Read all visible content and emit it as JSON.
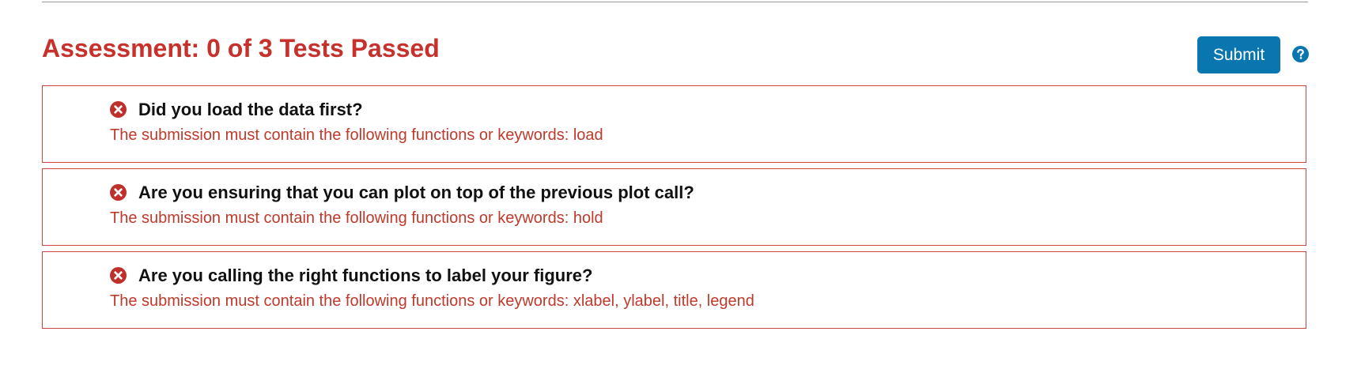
{
  "assessment": {
    "title": "Assessment: 0 of 3 Tests Passed",
    "submit_label": "Submit",
    "help_icon": "question-circle-icon"
  },
  "tests": [
    {
      "title": "Did you load the data first?",
      "message": "The submission must contain the following functions or keywords: load",
      "status": "failed",
      "icon": "x-circle-icon"
    },
    {
      "title": "Are you ensuring that you can plot on top of the previous plot call?",
      "message": "The submission must contain the following functions or keywords: hold",
      "status": "failed",
      "icon": "x-circle-icon"
    },
    {
      "title": "Are you calling the right functions to label your figure?",
      "message": "The submission must contain the following functions or keywords: xlabel, ylabel, title, legend",
      "status": "failed",
      "icon": "x-circle-icon"
    }
  ],
  "colors": {
    "fail_red": "#c8312b",
    "card_border": "#cc4440",
    "submit_blue": "#0a76b0"
  }
}
